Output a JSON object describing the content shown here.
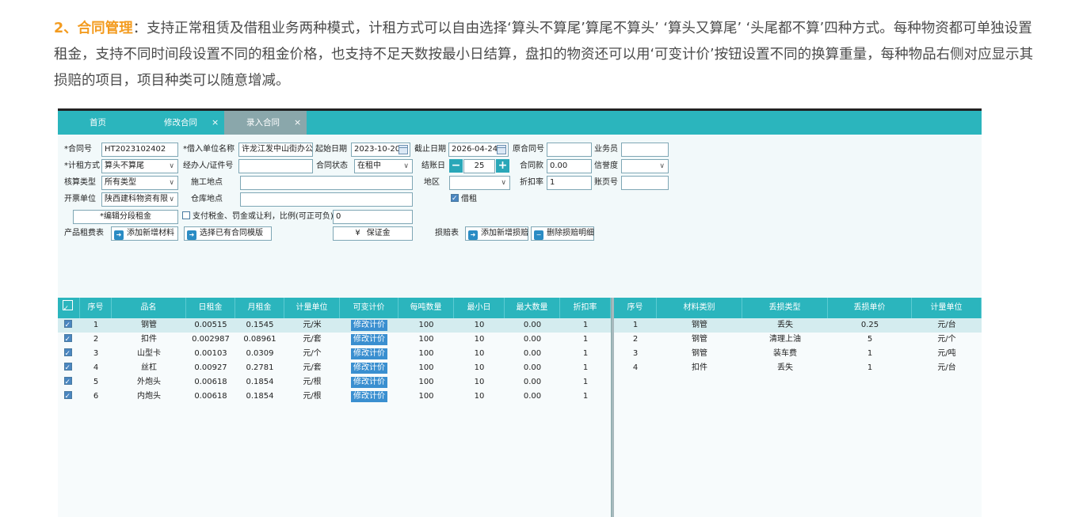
{
  "intro": {
    "highlight": "2、合同管理",
    "text": "：支持正常租赁及借租业务两种模式，计租方式可以自由选择‘算头不算尾’算尾不算头’ ‘算头又算尾’ ‘头尾都不算’四种方式。每种物资都可单独设置租金，支持不同时间段设置不同的租金价格，也支持不足天数按最小日结算，盘扣的物资还可以用‘可变计价’按钮设置不同的换算重量，每种物品右侧对应显示其损赔的项目，项目种类可以随意增减。"
  },
  "tabs": [
    {
      "label": "首页",
      "closable": false,
      "active": false
    },
    {
      "label": "修改合同",
      "closable": true,
      "active": false
    },
    {
      "label": "录入合同",
      "closable": true,
      "active": true
    }
  ],
  "form": {
    "contract_no": {
      "label": "*合同号",
      "value": "HT2023102402"
    },
    "borrower": {
      "label": "*借入单位名称",
      "value": "许龙江发中山街办公"
    },
    "start_date": {
      "label": "起始日期",
      "value": "2023-10-20"
    },
    "end_date": {
      "label": "截止日期",
      "value": "2026-04-24"
    },
    "orig_contract": {
      "label": "原合同号",
      "value": ""
    },
    "salesman": {
      "label": "业务员",
      "value": ""
    },
    "rent_method": {
      "label": "*计租方式",
      "value": "算头不算尾"
    },
    "agent": {
      "label": "经办人/证件号",
      "value": ""
    },
    "contract_status": {
      "label": "合同状态",
      "value": "在租中"
    },
    "settle_day": {
      "label": "结账日",
      "value": "25"
    },
    "contract_amount": {
      "label": "合同款",
      "value": "0.00"
    },
    "credit": {
      "label": "信誉度",
      "value": ""
    },
    "calc_type": {
      "label": "核算类型",
      "value": "所有类型"
    },
    "site": {
      "label": "施工地点",
      "value": ""
    },
    "region": {
      "label": "地区",
      "value": ""
    },
    "discount": {
      "label": "折扣率",
      "value": "1"
    },
    "page_no": {
      "label": "账页号",
      "value": ""
    },
    "invoice_unit": {
      "label": "开票单位",
      "value": "陕西建科物资有限"
    },
    "warehouse": {
      "label": "仓库地点",
      "value": ""
    },
    "borrow_rent": {
      "label": "借租",
      "checked": true
    },
    "edit_segment": {
      "label": "*编辑分段租金"
    },
    "pay_tax": {
      "label": "支付税金、罚金或让利，比例(可正可负)",
      "value": "0",
      "checked": false
    },
    "product_rent_table": {
      "label": "产品租费表"
    },
    "add_material": {
      "label": "添加新增材料"
    },
    "select_template": {
      "label": "选择已有合同模版"
    },
    "deposit": {
      "label": "保证金"
    },
    "damage_table": {
      "label": "损赔表"
    },
    "add_damage": {
      "label": "添加新增损赔"
    },
    "delete_damage": {
      "label": "删除损赔明细"
    }
  },
  "left_table": {
    "columns": [
      "序号",
      "品名",
      "日租金",
      "月租金",
      "计量单位",
      "可变计价",
      "每吨数量",
      "最小日",
      "最大数量",
      "折扣率"
    ],
    "variable_price_label": "修改计价",
    "rows": [
      {
        "no": "1",
        "name": "钢管",
        "daily": "0.00515",
        "monthly": "0.1545",
        "unit": "元/米",
        "per_ton": "100",
        "min_day": "10",
        "max_qty": "0.00",
        "discount": "1"
      },
      {
        "no": "2",
        "name": "扣件",
        "daily": "0.002987",
        "monthly": "0.08961",
        "unit": "元/套",
        "per_ton": "100",
        "min_day": "10",
        "max_qty": "0.00",
        "discount": "1"
      },
      {
        "no": "3",
        "name": "山型卡",
        "daily": "0.00103",
        "monthly": "0.0309",
        "unit": "元/个",
        "per_ton": "100",
        "min_day": "10",
        "max_qty": "0.00",
        "discount": "1"
      },
      {
        "no": "4",
        "name": "丝杠",
        "daily": "0.00927",
        "monthly": "0.2781",
        "unit": "元/套",
        "per_ton": "100",
        "min_day": "10",
        "max_qty": "0.00",
        "discount": "1"
      },
      {
        "no": "5",
        "name": "外炮头",
        "daily": "0.00618",
        "monthly": "0.1854",
        "unit": "元/根",
        "per_ton": "100",
        "min_day": "10",
        "max_qty": "0.00",
        "discount": "1"
      },
      {
        "no": "6",
        "name": "内炮头",
        "daily": "0.00618",
        "monthly": "0.1854",
        "unit": "元/根",
        "per_ton": "100",
        "min_day": "10",
        "max_qty": "0.00",
        "discount": "1"
      }
    ]
  },
  "right_table": {
    "columns": [
      "序号",
      "材料类别",
      "丢损类型",
      "丢损单价",
      "计量单位"
    ],
    "rows": [
      {
        "no": "1",
        "category": "钢管",
        "type": "丢失",
        "price": "0.25",
        "unit": "元/台"
      },
      {
        "no": "2",
        "category": "钢管",
        "type": "清理上油",
        "price": "5",
        "unit": "元/个"
      },
      {
        "no": "3",
        "category": "钢管",
        "type": "装车费",
        "price": "1",
        "unit": "元/吨"
      },
      {
        "no": "4",
        "category": "扣件",
        "type": "丢失",
        "price": "1",
        "unit": "元/台"
      }
    ]
  }
}
